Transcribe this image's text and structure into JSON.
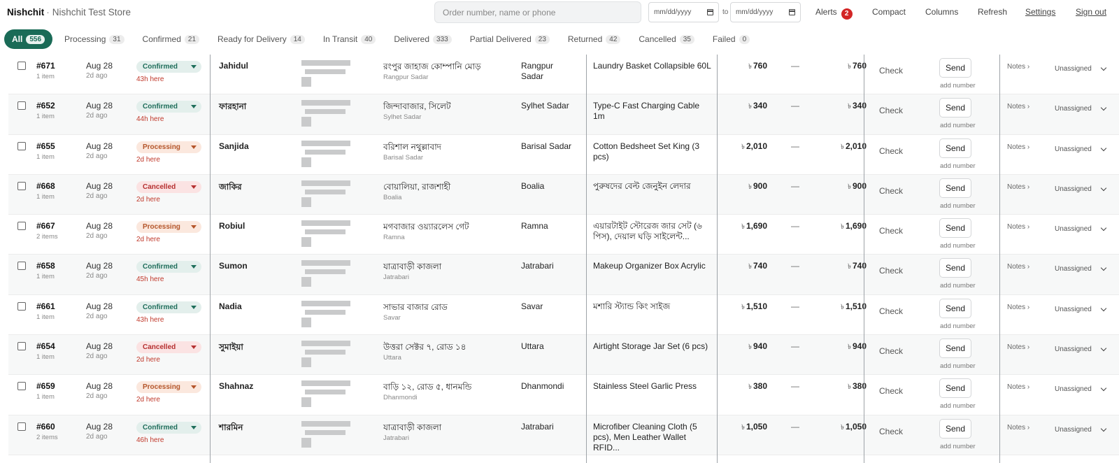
{
  "header": {
    "app_name": "Nishchit",
    "separator": "·",
    "store_name": "Nishchit Test Store",
    "search_placeholder": "Order number, name or phone",
    "date_from_placeholder": "mm/dd/yyyy",
    "date_to_placeholder": "mm/dd/yyyy",
    "date_separator": "to",
    "alerts_label": "Alerts",
    "alerts_count": "2",
    "compact_label": "Compact",
    "columns_label": "Columns",
    "refresh_label": "Refresh",
    "settings_label": "Settings",
    "signout_label": "Sign out"
  },
  "tabs": [
    {
      "label": "All",
      "count": "556",
      "active": true
    },
    {
      "label": "Processing",
      "count": "31"
    },
    {
      "label": "Confirmed",
      "count": "21"
    },
    {
      "label": "Ready for Delivery",
      "count": "14"
    },
    {
      "label": "In Transit",
      "count": "40"
    },
    {
      "label": "Delivered",
      "count": "333"
    },
    {
      "label": "Partial Delivered",
      "count": "23"
    },
    {
      "label": "Returned",
      "count": "42"
    },
    {
      "label": "Cancelled",
      "count": "35"
    },
    {
      "label": "Failed",
      "count": "0"
    }
  ],
  "labels": {
    "check": "Check",
    "send": "Send",
    "add_number": "add number",
    "notes": "Notes ›",
    "unassigned": "Unassigned",
    "currency": "৳",
    "dash": "—"
  },
  "orders": [
    {
      "id": "#671",
      "items": "1 item",
      "date": "Aug 28",
      "ago": "2d ago",
      "status": "Confirmed",
      "status_key": "confirmed",
      "hours": "43h here",
      "customer": "Jahidul",
      "address": "রংপুর জাহাজ কোম্পানি মোড়",
      "area": "Rangpur Sadar",
      "city": "Rangpur Sadar",
      "product": "Laundry Basket Collapsible 60L",
      "price": "760",
      "total": "760"
    },
    {
      "id": "#652",
      "items": "1 item",
      "date": "Aug 28",
      "ago": "2d ago",
      "status": "Confirmed",
      "status_key": "confirmed",
      "hours": "44h here",
      "customer": "ফারহানা",
      "address": "জিন্দাবাজার, সিলেট",
      "area": "Sylhet Sadar",
      "city": "Sylhet Sadar",
      "product": "Type-C Fast Charging Cable 1m",
      "price": "340",
      "total": "340"
    },
    {
      "id": "#655",
      "items": "1 item",
      "date": "Aug 28",
      "ago": "2d ago",
      "status": "Processing",
      "status_key": "processing",
      "hours": "2d here",
      "customer": "Sanjida",
      "address": "বরিশাল নথুল্লাবাদ",
      "area": "Barisal Sadar",
      "city": "Barisal Sadar",
      "product": "Cotton Bedsheet Set King (3 pcs)",
      "price": "2,010",
      "total": "2,010"
    },
    {
      "id": "#668",
      "items": "1 item",
      "date": "Aug 28",
      "ago": "2d ago",
      "status": "Cancelled",
      "status_key": "cancelled",
      "hours": "2d here",
      "customer": "জাকির",
      "address": "বোয়ালিয়া, রাজশাহী",
      "area": "Boalia",
      "city": "Boalia",
      "product": "পুরুষদের বেল্ট জেনুইন লেদার",
      "price": "900",
      "total": "900"
    },
    {
      "id": "#667",
      "items": "2 items",
      "date": "Aug 28",
      "ago": "2d ago",
      "status": "Processing",
      "status_key": "processing",
      "hours": "2d here",
      "customer": "Robiul",
      "address": "মগবাজার ওয়্যারলেস গেট",
      "area": "Ramna",
      "city": "Ramna",
      "product": "এয়ারটাইট স্টোরেজ জার সেট (৬ পিস), দেয়াল ঘড়ি সাইলেন্ট...",
      "price": "1,690",
      "total": "1,690"
    },
    {
      "id": "#658",
      "items": "1 item",
      "date": "Aug 28",
      "ago": "2d ago",
      "status": "Confirmed",
      "status_key": "confirmed",
      "hours": "45h here",
      "customer": "Sumon",
      "address": "যাত্রাবাড়ী কাজলা",
      "area": "Jatrabari",
      "city": "Jatrabari",
      "product": "Makeup Organizer Box Acrylic",
      "price": "740",
      "total": "740"
    },
    {
      "id": "#661",
      "items": "1 item",
      "date": "Aug 28",
      "ago": "2d ago",
      "status": "Confirmed",
      "status_key": "confirmed",
      "hours": "43h here",
      "customer": "Nadia",
      "address": "সাভার বাজার রোড",
      "area": "Savar",
      "city": "Savar",
      "product": "মশারি স্ট্যান্ড কিং সাইজ",
      "price": "1,510",
      "total": "1,510"
    },
    {
      "id": "#654",
      "items": "1 item",
      "date": "Aug 28",
      "ago": "2d ago",
      "status": "Cancelled",
      "status_key": "cancelled",
      "hours": "2d here",
      "customer": "সুমাইয়া",
      "address": "উত্তরা সেক্টর ৭, রোড ১৪",
      "area": "Uttara",
      "city": "Uttara",
      "product": "Airtight Storage Jar Set (6 pcs)",
      "price": "940",
      "total": "940"
    },
    {
      "id": "#659",
      "items": "1 item",
      "date": "Aug 28",
      "ago": "2d ago",
      "status": "Processing",
      "status_key": "processing",
      "hours": "2d here",
      "customer": "Shahnaz",
      "address": "বাড়ি ১২, রোড ৫, ধানমন্ডি",
      "area": "Dhanmondi",
      "city": "Dhanmondi",
      "product": "Stainless Steel Garlic Press",
      "price": "380",
      "total": "380"
    },
    {
      "id": "#660",
      "items": "2 items",
      "date": "Aug 28",
      "ago": "2d ago",
      "status": "Confirmed",
      "status_key": "confirmed",
      "hours": "46h here",
      "customer": "শারমিন",
      "address": "যাত্রাবাড়ী কাজলা",
      "area": "Jatrabari",
      "city": "Jatrabari",
      "product": "Microfiber Cleaning Cloth (5 pcs), Men Leather Wallet RFID...",
      "price": "1,050",
      "total": "1,050"
    }
  ]
}
